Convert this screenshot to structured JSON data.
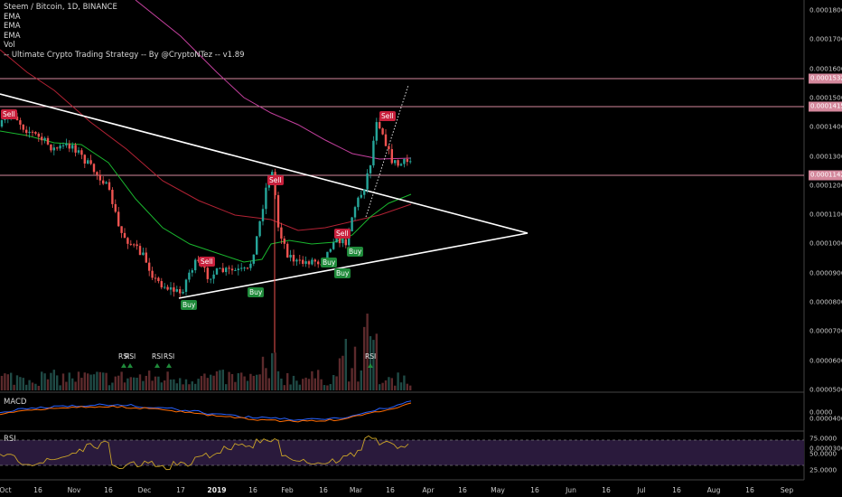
{
  "legend": {
    "title": "Steem / Bitcoin, 1D, BINANCE",
    "lines": [
      "EMA",
      "EMA",
      "EMA",
      "Vol",
      "-- Ultimate Crypto Trading Strategy -- By @CryptoNTez -- v1.89"
    ]
  },
  "panes": {
    "macd_label": "MACD",
    "rsi_label": "RSI"
  },
  "price_axis": [
    "0.0001800",
    "0.0001700",
    "0.0001600",
    "0.0001500",
    "0.0001400",
    "0.0001300",
    "0.0001200",
    "0.0001100",
    "0.0001000",
    "0.0000900",
    "0.0000800",
    "0.0000700",
    "0.0000600",
    "0.0000500",
    "0.0000400",
    "0.0000300"
  ],
  "price_tags": [
    "0.0001532",
    "0.0001415",
    "0.0001142"
  ],
  "macd_axis": [
    "0.0000"
  ],
  "rsi_axis": [
    "75.0000",
    "50.0000",
    "25.0000"
  ],
  "date_axis": [
    "Oct",
    "16",
    "Nov",
    "16",
    "Dec",
    "17",
    "2019",
    "16",
    "Feb",
    "16",
    "Mar",
    "16",
    "Apr",
    "16",
    "May",
    "16",
    "Jun",
    "16",
    "Jul",
    "16",
    "Aug",
    "16",
    "Sep"
  ],
  "signals": {
    "sell": [
      "Sell",
      "Sell",
      "Sell",
      "Sell",
      "Sell"
    ],
    "buy": [
      "Buy",
      "Buy",
      "Buy",
      "Buy",
      "Buy"
    ]
  },
  "rsi_markers": [
    "RSI",
    "RSI",
    "RSI",
    "RSI",
    "RSI"
  ],
  "colors": {
    "up": "#26a69a",
    "down": "#ef5350",
    "ema_fast": "#19b52e",
    "ema_mid": "#b22234",
    "ema_slow": "#c4409e",
    "trendline": "#ffffff",
    "hline": "#d4889c",
    "macd": "#2962ff",
    "signal": "#ff6d00",
    "rsi": "#c9a227",
    "rsi_band": "#2a1a3c"
  }
}
